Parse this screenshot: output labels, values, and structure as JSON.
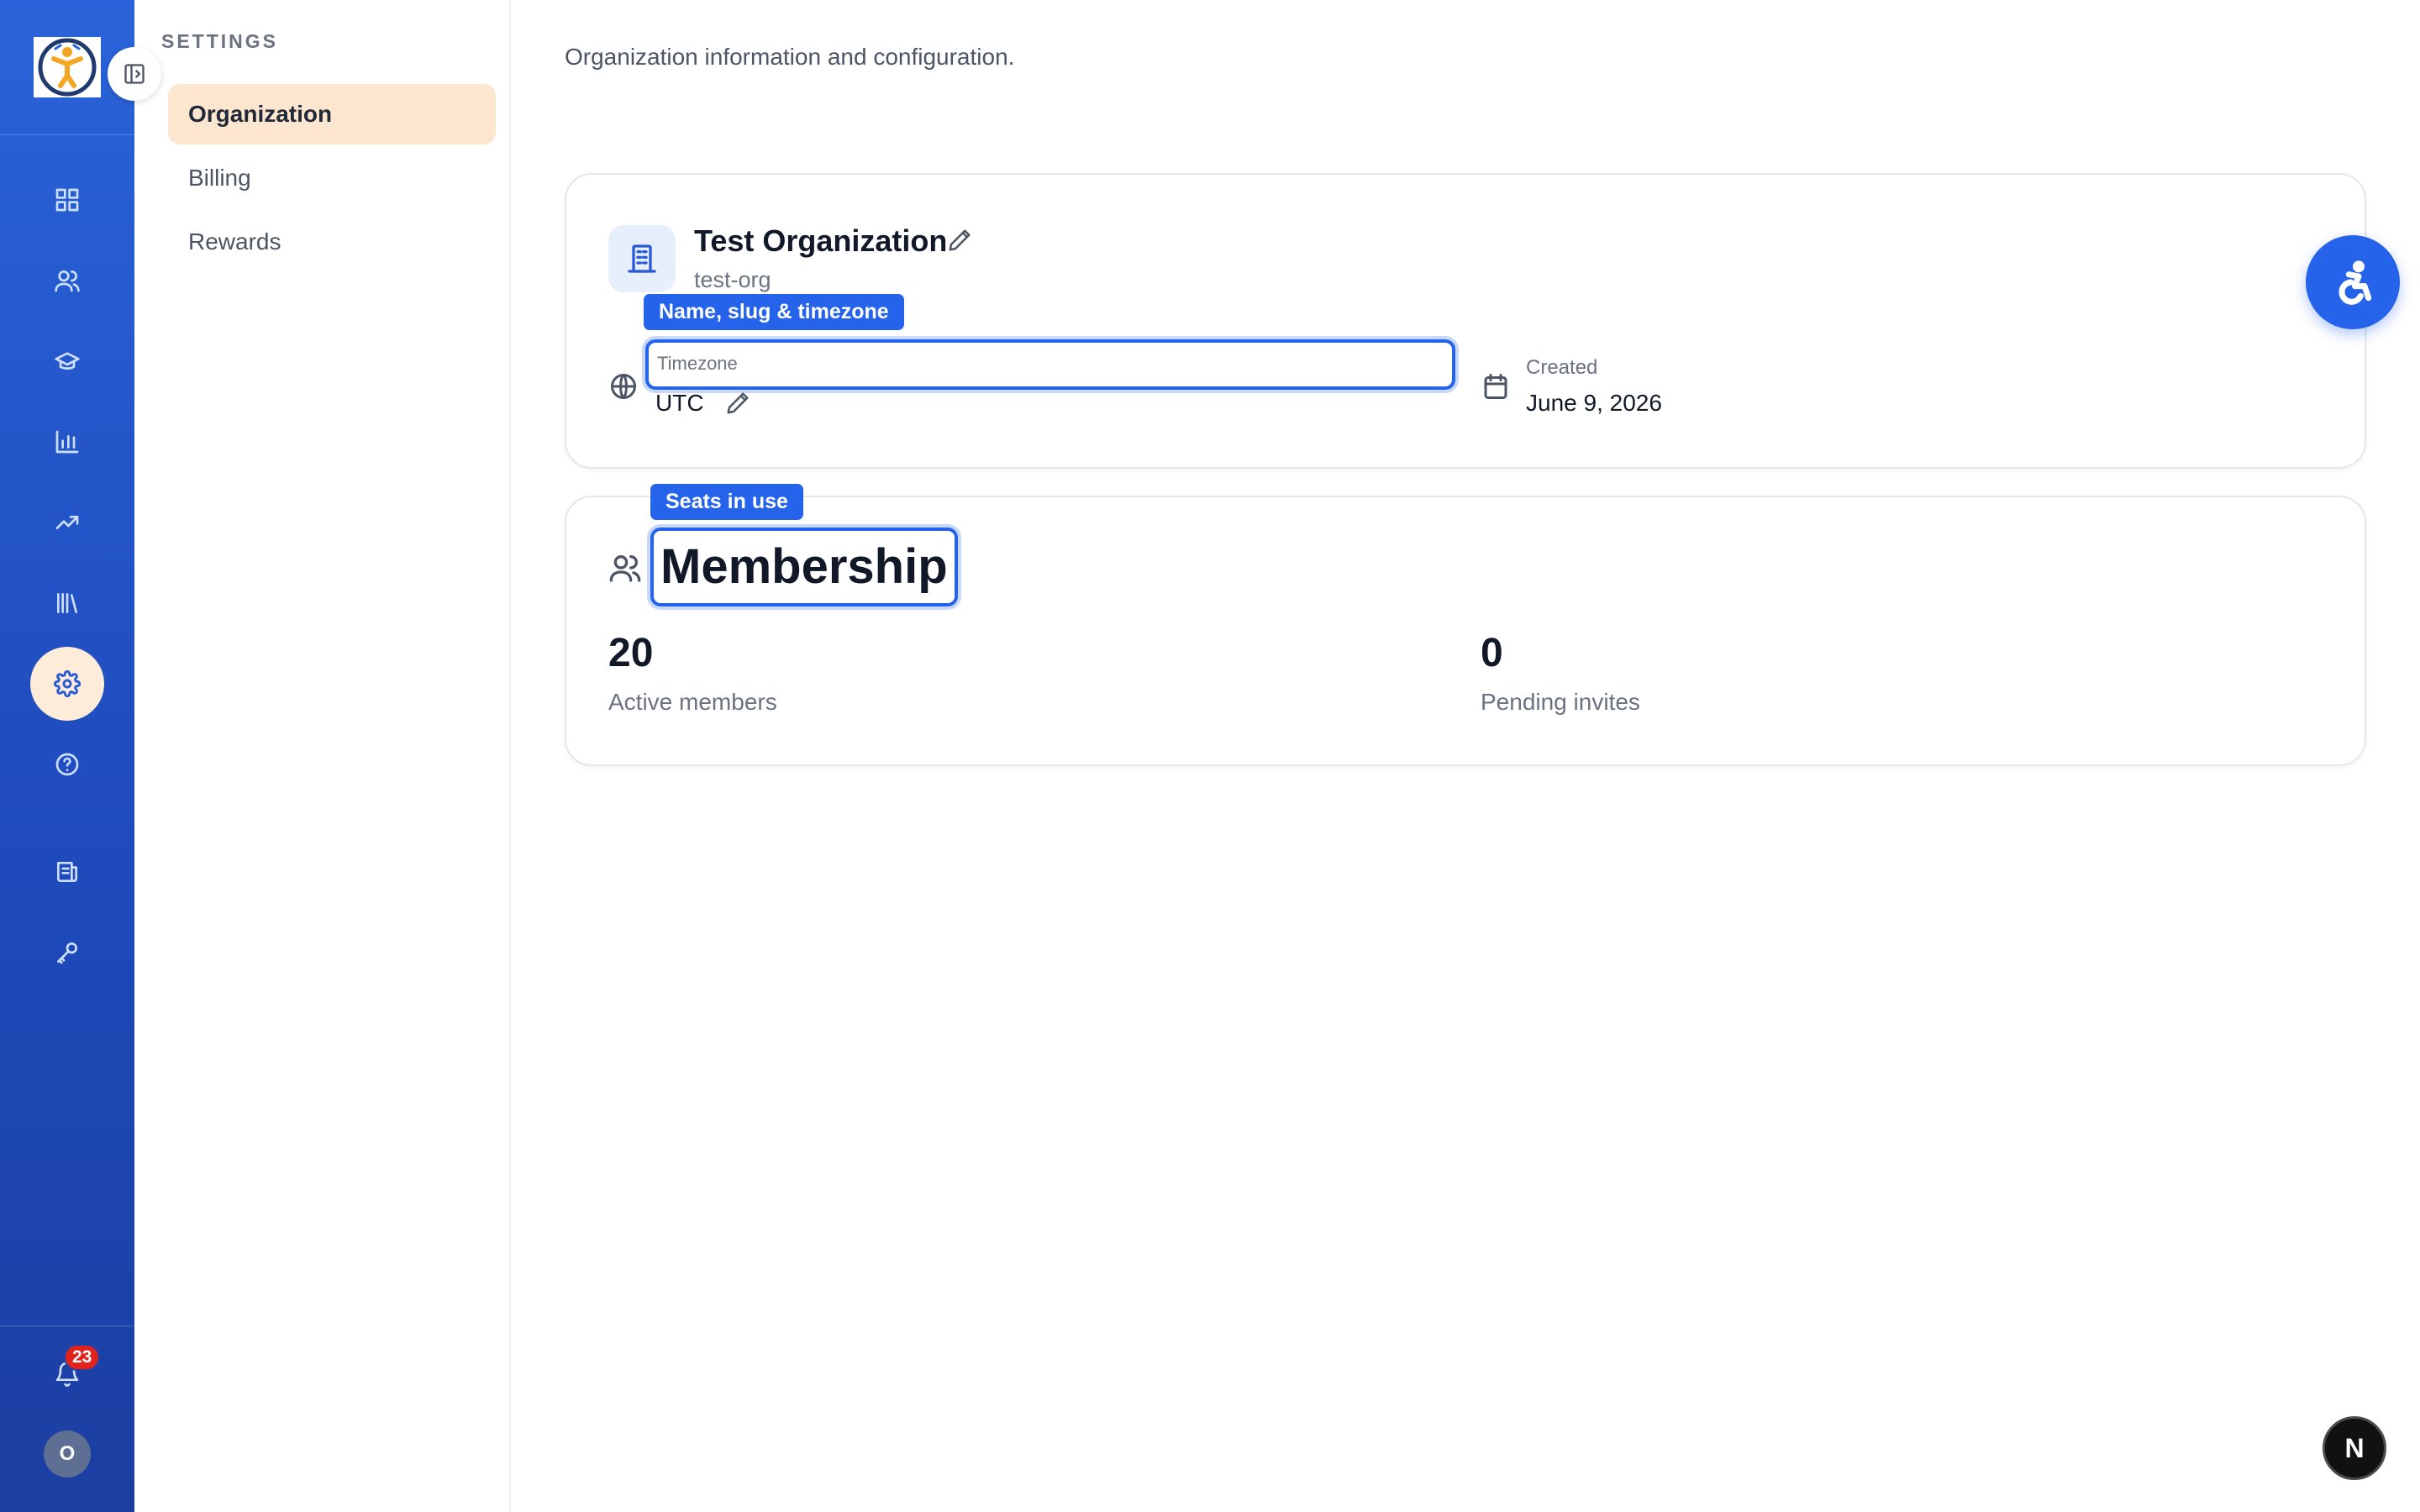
{
  "sidebar": {
    "heading": "SETTINGS",
    "items": [
      {
        "label": "Organization"
      },
      {
        "label": "Billing"
      },
      {
        "label": "Rewards"
      }
    ]
  },
  "rail": {
    "icons": [
      "dashboard-icon",
      "users-icon",
      "graduation-cap-icon",
      "bar-chart-icon",
      "trending-up-icon",
      "library-icon",
      "settings-icon",
      "help-icon",
      "scroll-icon",
      "key-icon",
      "bell-icon"
    ],
    "notification_count": "23",
    "avatar_initial": "O"
  },
  "main": {
    "subtitle": "Organization information and configuration."
  },
  "org_card": {
    "name": "Test Organization",
    "slug": "test-org",
    "highlight_label": "Name, slug & timezone",
    "timezone_label": "Timezone",
    "timezone_value": "UTC",
    "created_label": "Created",
    "created_value": "June 9, 2026"
  },
  "membership_card": {
    "highlight_label": "Seats in use",
    "title": "Membership",
    "active_members": "20",
    "active_members_label": "Active members",
    "pending_invites": "0",
    "pending_invites_label": "Pending invites"
  },
  "floating": {
    "next_badge": "N"
  },
  "colors": {
    "brand_blue": "#2563eb",
    "rail_gradient_top": "#2a63d9",
    "active_nav_bg": "#fde6cf",
    "notification_red": "#e0231b"
  }
}
